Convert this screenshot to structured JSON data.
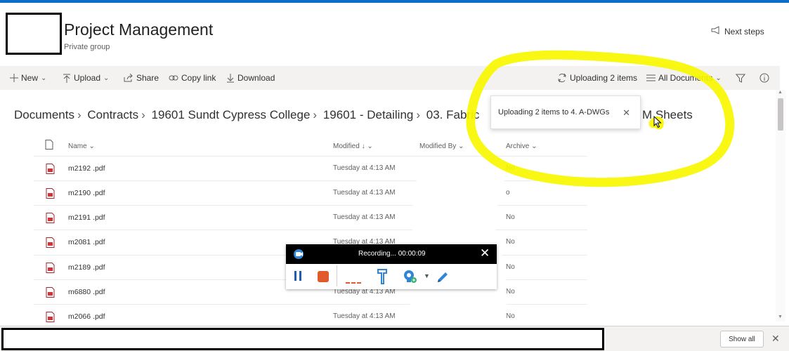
{
  "site": {
    "title": "Project Management",
    "subtitle": "Private group",
    "next_steps": "Next steps"
  },
  "toolbar": {
    "new": "New",
    "upload": "Upload",
    "share": "Share",
    "copy_link": "Copy link",
    "download": "Download",
    "uploading_status": "Uploading 2 items",
    "view": "All Documents"
  },
  "toast": {
    "text": "Uploading 2 items to 4. A-DWGs"
  },
  "breadcrumb": {
    "items": [
      "Documents",
      "Contracts",
      "19601 Sundt Cypress College",
      "19601 - Detailing",
      "03. Fabric"
    ],
    "tail": "M Sheets"
  },
  "table": {
    "headers": {
      "name": "Name",
      "modified": "Modified",
      "modified_by": "Modified By",
      "archive": "Archive"
    },
    "rows": [
      {
        "name": "m2192 .pdf",
        "modified": "Tuesday at 4:13 AM",
        "archive": "No"
      },
      {
        "name": "m2190 .pdf",
        "modified": "Tuesday at 4:13 AM",
        "archive": "o"
      },
      {
        "name": "m2191 .pdf",
        "modified": "Tuesday at 4:13 AM",
        "archive": "No"
      },
      {
        "name": "m2081 .pdf",
        "modified": "Tuesday at 4:13 AM",
        "archive": "No"
      },
      {
        "name": "m2189 .pdf",
        "modified": "",
        "archive": "No"
      },
      {
        "name": "m6880 .pdf",
        "modified": "Tuesday at 4:13 AM",
        "archive": "No"
      },
      {
        "name": "m2066 .pdf",
        "modified": "Tuesday at 4:13 AM",
        "archive": "No"
      }
    ]
  },
  "recorder": {
    "status": "Recording... 00:00:09"
  },
  "bottom": {
    "show_all": "Show all"
  },
  "colors": {
    "accent": "#0b6fc7",
    "pdf_red": "#d13438",
    "annotation_yellow": "#f7f700",
    "record_red": "#e05a2b"
  },
  "icons": [
    "plus-icon",
    "upload-icon",
    "share-icon",
    "link-icon",
    "download-icon",
    "sync-icon",
    "list-icon",
    "filter-icon",
    "info-icon",
    "megaphone-icon",
    "doc-icon",
    "pdf-icon",
    "pause-icon",
    "stop-icon",
    "pen-icon"
  ]
}
